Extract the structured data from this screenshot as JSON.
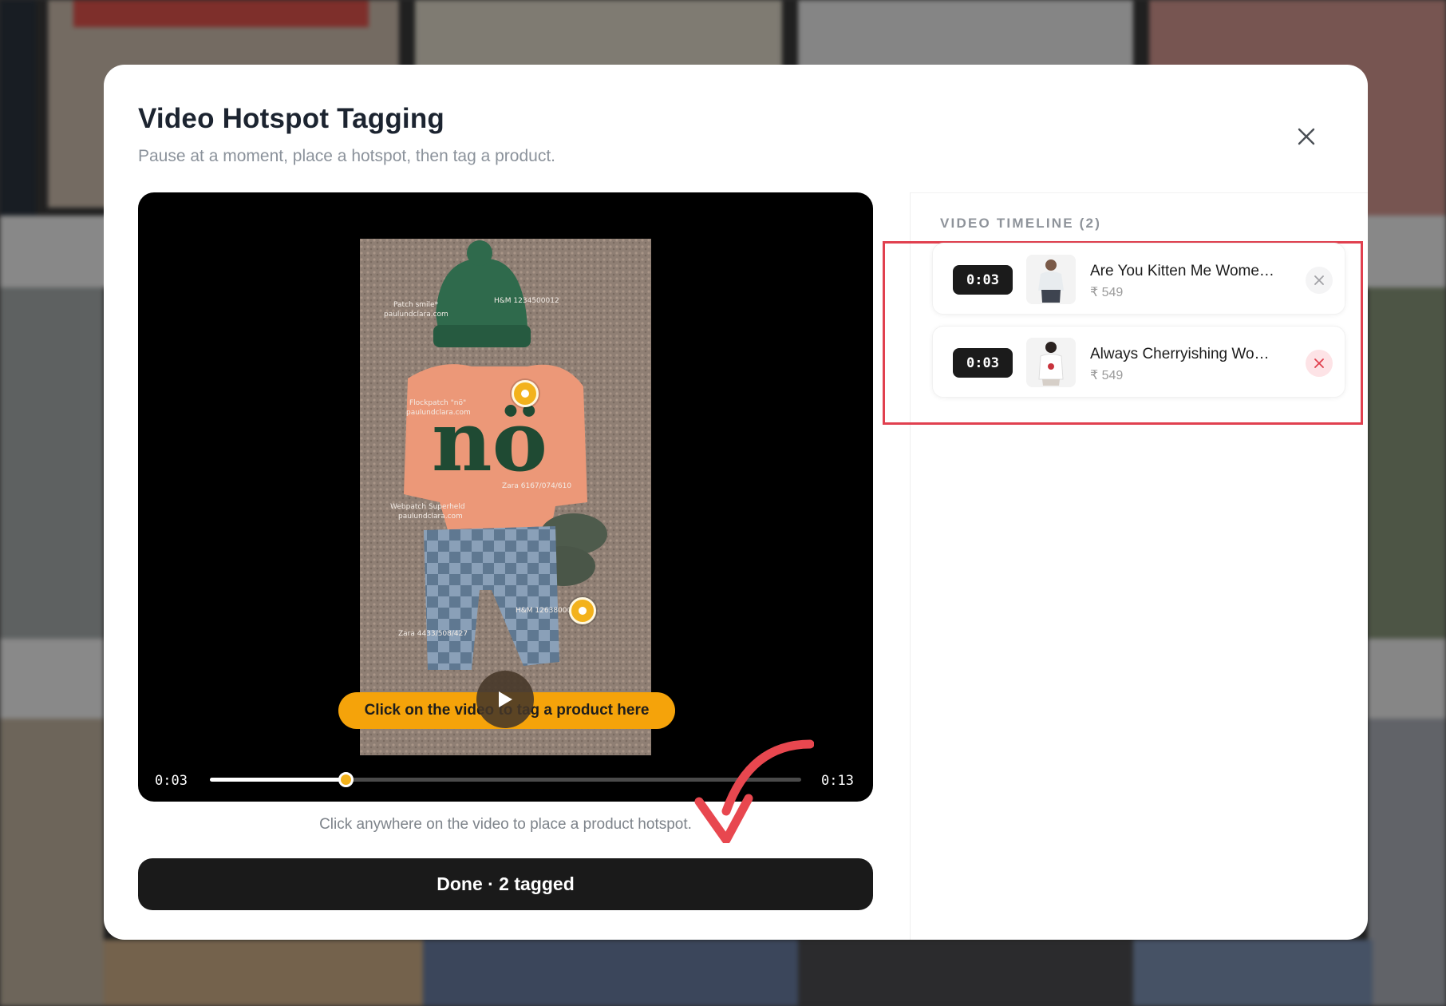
{
  "modal": {
    "title": "Video Hotspot Tagging",
    "subtitle": "Pause at a moment, place a hotspot, then tag a product.",
    "close_icon": "close-icon"
  },
  "player": {
    "overlay_cta": "Click on the video to tag a product here",
    "current_time": "0:03",
    "duration": "0:13",
    "progress_fraction": 0.23,
    "accent_color": "#f3b21c",
    "frame_labels": [
      "Patch smile* paulundclara.com",
      "H&M 1234500012",
      "Flockpatch \"no\" paulundclara.com",
      "Zara 6167/074/610",
      "Webpatch Superheld paulundclara.com",
      "H&M 1263800012",
      "Zara 4433/508/427"
    ]
  },
  "hint": "Click anywhere on the video to place a product hotspot.",
  "done_button": {
    "label": "Done · 2 tagged"
  },
  "timeline": {
    "heading": "VIDEO TIMELINE (2)",
    "highlight_color": "#e1404f",
    "items": [
      {
        "time": "0:03",
        "name": "Are You Kitten Me Wome…",
        "price": "₹ 549"
      },
      {
        "time": "0:03",
        "name": "Always Cherryishing Wo…",
        "price": "₹ 549"
      }
    ]
  }
}
